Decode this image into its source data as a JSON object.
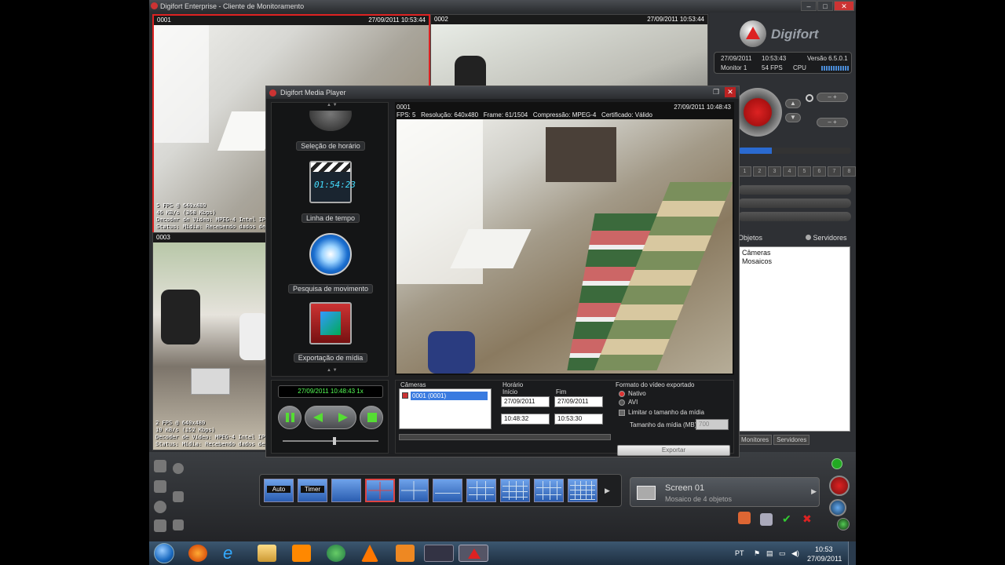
{
  "app": {
    "title": "Digifort Enterprise - Cliente de Monitoramento"
  },
  "cameras": [
    {
      "id": "0001",
      "timestamp": "27/09/2011 10:53:44",
      "info": [
        "5 FPS @ 640x480",
        "46 KB/s (368 Kbps)",
        "Decoder de Video: MPEG-4 Intel IPP",
        "Status: Mídia: Recebendo dados de mídi"
      ]
    },
    {
      "id": "0002",
      "timestamp": "27/09/2011 10:53:44",
      "info": []
    },
    {
      "id": "0003",
      "timestamp": "",
      "info": [
        "2 FPS @ 640x480",
        "19 KB/s (152 Kbps)",
        "Decoder de Vídeo: MPEG-4 Intel IPP",
        "Status: Mídia: Recebendo dados de mídi"
      ]
    }
  ],
  "right_panel": {
    "logo_text": "Digifort",
    "date": "27/09/2011",
    "time": "10:53:43",
    "version": "Versão 6.5.0.1",
    "monitor": "Monitor 1",
    "fps": "54 FPS",
    "cpu_label": "CPU",
    "preset_numbers": [
      "1",
      "2",
      "3",
      "4",
      "5",
      "6",
      "7",
      "8"
    ],
    "tab_objects": "Objetos",
    "tab_servers": "Servidores",
    "tree_items": [
      "Câmeras",
      "Mosaicos"
    ],
    "bottom_tabs": [
      "Monitores",
      "Servidores"
    ]
  },
  "bottom_bar": {
    "layout_buttons": [
      "Auto",
      "Timer"
    ],
    "screen_title": "Screen 01",
    "screen_subtitle": "Mosaico de 4 objetos"
  },
  "media_player": {
    "title": "Digifort Media Player",
    "menu_items": [
      "Seleção de horário",
      "Linha de tempo",
      "Pesquisa de movimento",
      "Exportação de mídia"
    ],
    "clapboard_time": "01:54:23",
    "video": {
      "camera_id": "0001",
      "timestamp": "27/09/2011 10:48:43",
      "fps": "FPS: 5",
      "resolution": "Resolução: 640x480",
      "frame": "Frame: 61/1504",
      "compression": "Compressão: MPEG-4",
      "certificate": "Certificado: Válido"
    },
    "playback_time": "27/09/2011 10:48:43 1x",
    "export": {
      "cameras_label": "Câmeras",
      "camera_item": "0001 (0001)",
      "schedule_label": "Horário",
      "start_label": "Início",
      "end_label": "Fim",
      "start_date": "27/09/2011",
      "end_date": "27/09/2011",
      "start_time": "10:48:32",
      "end_time": "10:53:30",
      "format_label": "Formato do vídeo exportado",
      "format_native": "Nativo",
      "format_avi": "AVI",
      "limit_label": "Limitar o tamanho da mídia",
      "size_label": "Tamanho da mídia (MB):",
      "size_value": "700",
      "export_button": "Exportar"
    }
  },
  "taskbar": {
    "lang": "PT",
    "time": "10:53",
    "date": "27/09/2011"
  }
}
